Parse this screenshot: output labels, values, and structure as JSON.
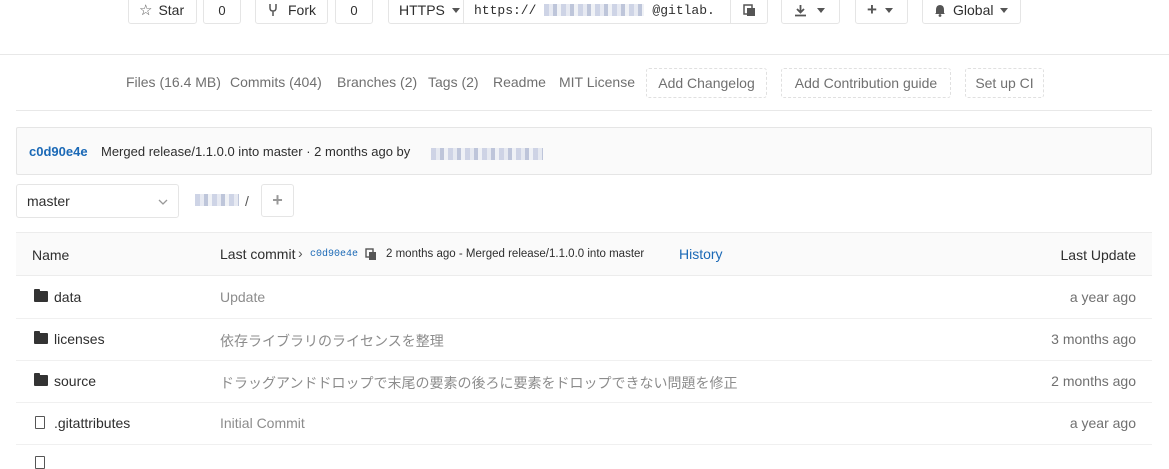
{
  "top": {
    "star_label": "Star",
    "star_count": "0",
    "fork_label": "Fork",
    "fork_count": "0",
    "protocol": "HTTPS",
    "url_prefix": "https://",
    "url_suffix": "@gitlab.",
    "global_label": "Global"
  },
  "nav": {
    "files": "Files (16.4 MB)",
    "commits": "Commits (404)",
    "branches": "Branches (2)",
    "tags": "Tags (2)",
    "readme": "Readme",
    "license": "MIT License",
    "add_changelog": "Add Changelog",
    "add_contribution": "Add Contribution guide",
    "setup_ci": "Set up CI"
  },
  "commit_bar": {
    "sha": "c0d90e4e",
    "message": "Merged release/1.1.0.0 into master · 2 months ago by"
  },
  "branch": {
    "selected": "master",
    "path_separator": "/"
  },
  "table": {
    "header": {
      "name": "Name",
      "last_commit": "Last commit",
      "sha": "c0d90e4e",
      "summary": "2 months ago - Merged release/1.1.0.0 into master",
      "history": "History",
      "last_update": "Last Update"
    },
    "rows": [
      {
        "type": "folder",
        "name": "data",
        "message": "Update",
        "date": "a year ago"
      },
      {
        "type": "folder",
        "name": "licenses",
        "message": "依存ライブラリのライセンスを整理",
        "date": "3 months ago"
      },
      {
        "type": "folder",
        "name": "source",
        "message": "ドラッグアンドドロップで末尾の要素の後ろに要素をドロップできない問題を修正",
        "date": "2 months ago"
      },
      {
        "type": "file",
        "name": ".gitattributes",
        "message": "Initial Commit",
        "date": "a year ago"
      }
    ]
  },
  "colors": {
    "link": "#1b69b6",
    "muted": "#707070",
    "border": "#e5e5e5"
  }
}
